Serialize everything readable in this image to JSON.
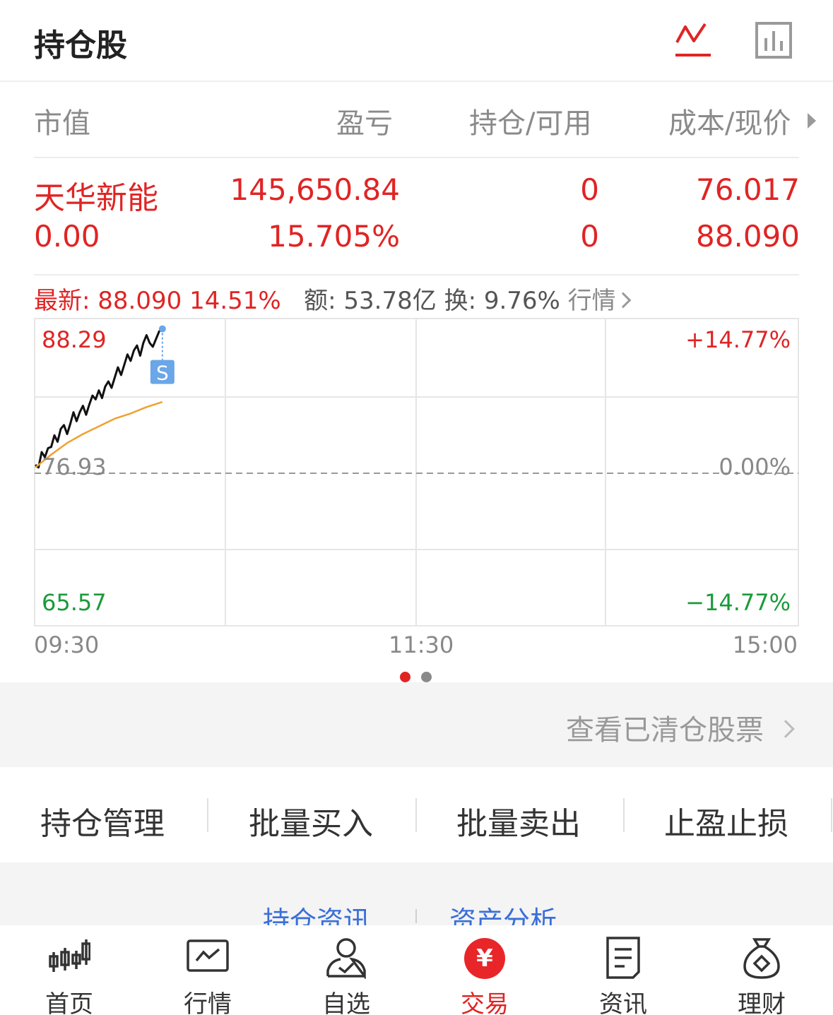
{
  "header": {
    "title": "持仓股",
    "line_icon_color": "#e02424",
    "bar_icon_color": "#9a9a9a"
  },
  "table": {
    "columns": [
      "市值",
      "盈亏",
      "持仓/可用",
      "成本/现价"
    ],
    "rows": [
      {
        "name": "天华新能",
        "market_value": "0.00",
        "profit": "145,650.84",
        "profit_pct": "15.705%",
        "position": "0",
        "available": "0",
        "cost": "76.017",
        "price": "88.090"
      }
    ]
  },
  "quote": {
    "latest_label": "最新:",
    "latest_price": "88.090",
    "latest_change": "14.51%",
    "amount": "额: 53.78亿",
    "turnover": "换: 9.76%",
    "market_link": "行情"
  },
  "chart_data": {
    "type": "line",
    "title": "",
    "y_high": "88.29",
    "y_base": "76.93",
    "y_low": "65.57",
    "pct_high": "+14.77%",
    "pct_base": "0.00%",
    "pct_low": "−14.77%",
    "x_labels": [
      "09:30",
      "11:30",
      "15:00"
    ],
    "ylim": [
      65.57,
      88.29
    ],
    "series": [
      {
        "color": "#111111",
        "x": [
          0,
          1,
          2,
          3,
          4,
          5,
          6,
          7,
          8,
          9,
          10,
          11,
          12,
          13,
          14,
          15,
          16,
          17,
          18,
          19,
          20,
          21,
          22,
          23,
          24,
          25,
          26,
          27,
          28,
          29,
          30,
          31,
          32,
          33,
          34,
          35,
          36,
          37,
          38,
          39,
          40
        ],
        "values": [
          77.5,
          77.3,
          78.5,
          78.1,
          78.8,
          78.9,
          79.8,
          79.3,
          80.3,
          80.6,
          79.9,
          80.7,
          81.6,
          80.9,
          81.6,
          82.1,
          81.4,
          82.2,
          82.9,
          82.6,
          83.3,
          82.7,
          83.6,
          84.0,
          83.5,
          84.3,
          85.1,
          84.5,
          85.3,
          86.1,
          85.6,
          86.4,
          86.8,
          86.0,
          87.0,
          87.6,
          87.0,
          86.7,
          87.3,
          87.9,
          88.09
        ]
      },
      {
        "color": "#f0a030",
        "x": [
          0,
          5,
          10,
          15,
          20,
          25,
          30,
          35,
          40
        ],
        "values": [
          77.3,
          78.3,
          79.2,
          79.9,
          80.5,
          81.1,
          81.5,
          82.0,
          82.4
        ]
      }
    ],
    "total_minutes": 240,
    "marker_label": "S",
    "marker_color": "#6aa6e8"
  },
  "pager": {
    "active_color": "#e02424",
    "inactive_color": "#8a8a8a"
  },
  "cleared_link": "查看已清仓股票",
  "actions": [
    "持仓管理",
    "批量买入",
    "批量卖出",
    "止盈止损"
  ],
  "links": [
    "持仓资讯",
    "资产分析"
  ],
  "tabs": [
    {
      "label": "首页",
      "icon": "candlestick-icon"
    },
    {
      "label": "行情",
      "icon": "market-chart-icon"
    },
    {
      "label": "自选",
      "icon": "user-check-icon"
    },
    {
      "label": "交易",
      "icon": "yen-icon",
      "symbol": "¥"
    },
    {
      "label": "资讯",
      "icon": "document-icon"
    },
    {
      "label": "理财",
      "icon": "money-bag-icon"
    }
  ]
}
